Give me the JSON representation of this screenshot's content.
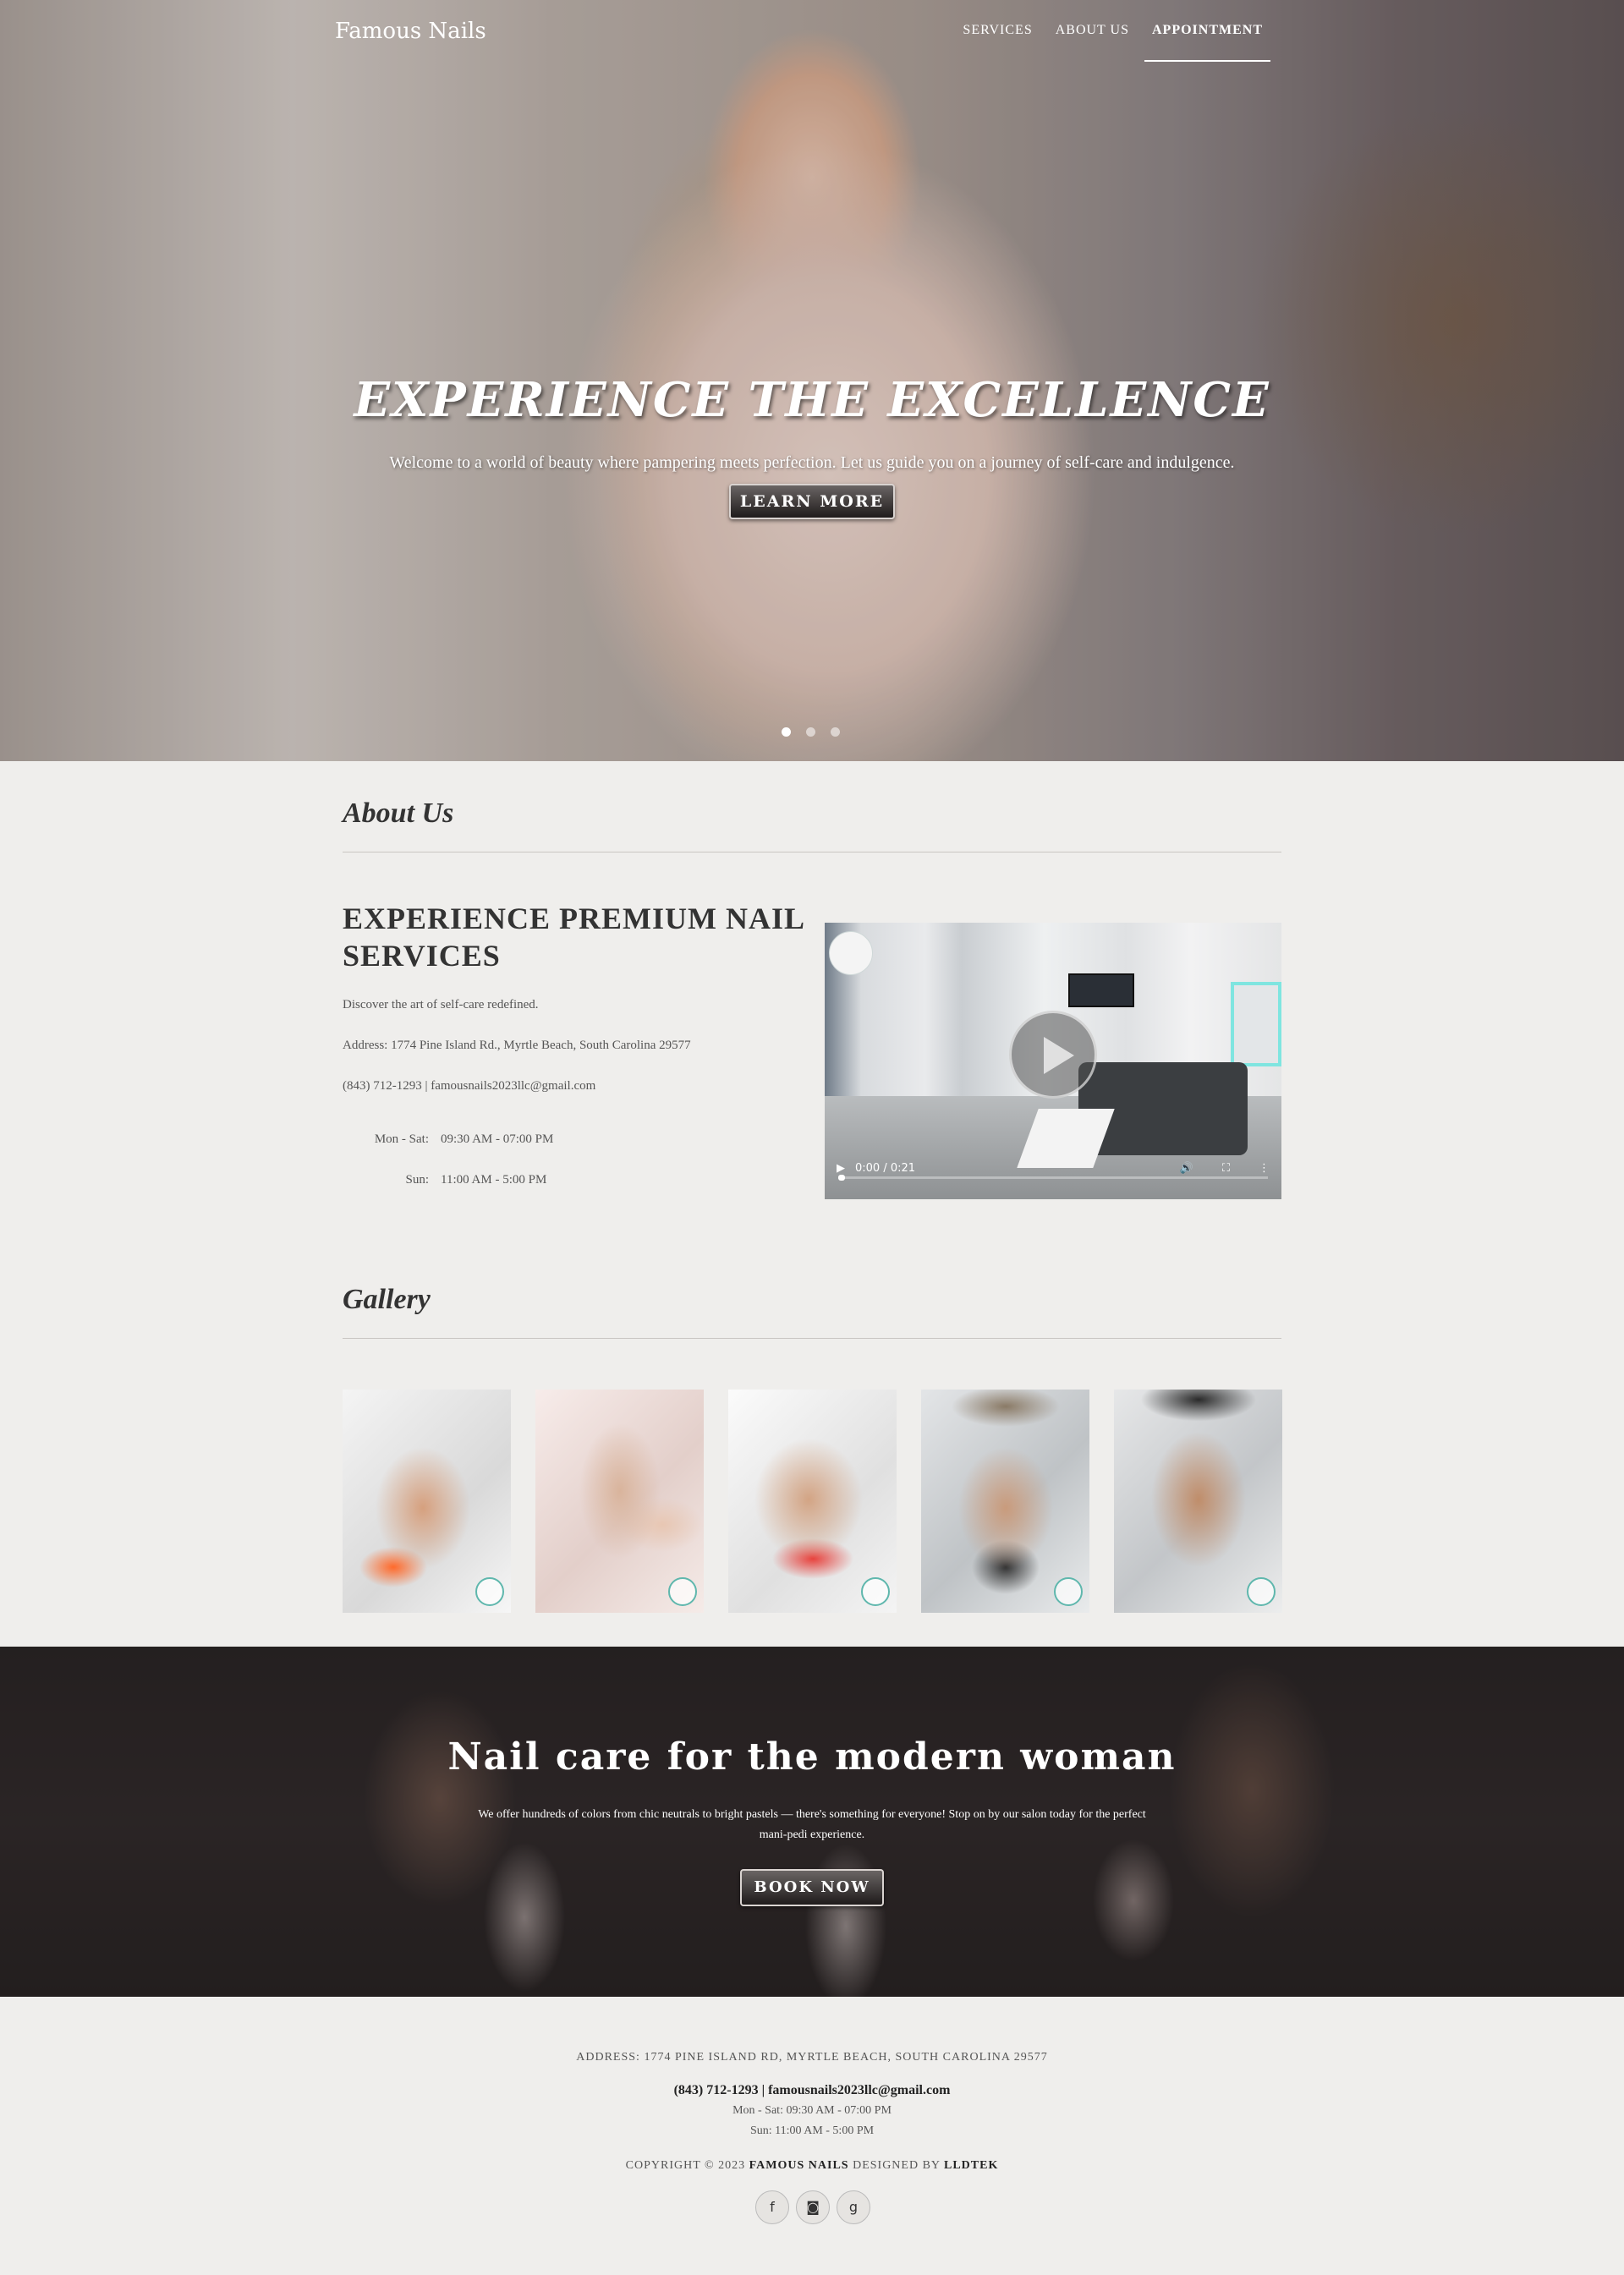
{
  "nav": {
    "brand": "Famous Nails",
    "links": [
      "SERVICES",
      "ABOUT US",
      "APPOINTMENT"
    ],
    "active": "APPOINTMENT"
  },
  "hero": {
    "title": "EXPERIENCE THE EXCELLENCE",
    "subtitle": "Welcome to a world of beauty where pampering meets perfection. Let us guide you on a journey of self-care and indulgence.",
    "button": "LEARN MORE",
    "slide_count": 3,
    "active_slide": 1
  },
  "about": {
    "section_title": "About Us",
    "heading": "EXPERIENCE PREMIUM NAIL SERVICES",
    "tagline": "Discover the art of self-care redefined.",
    "address": "Address: 1774 Pine Island Rd., Myrtle Beach, South Carolina 29577",
    "contact": "(843) 712-1293 | famousnails2023llc@gmail.com",
    "hours": [
      {
        "label": "Mon - Sat:",
        "value": "09:30 AM - 07:00 PM"
      },
      {
        "label": "Sun:",
        "value": "11:00 AM - 5:00 PM"
      }
    ],
    "video": {
      "time": "0:00 / 0:21",
      "progress": 0
    }
  },
  "gallery": {
    "section_title": "Gallery",
    "items": [
      "gallery-photo-1",
      "gallery-photo-2",
      "gallery-photo-3",
      "gallery-photo-4",
      "gallery-photo-5"
    ]
  },
  "banner": {
    "title": "Nail care for the modern woman",
    "text": "We offer hundreds of colors from chic neutrals to bright pastels — there's something for everyone! Stop on by our salon today for the perfect mani-pedi experience.",
    "button": "BOOK NOW"
  },
  "footer": {
    "address": "ADDRESS: 1774 PINE ISLAND RD, MYRTLE BEACH, SOUTH CAROLINA 29577",
    "contact": "(843) 712-1293 | famousnails2023llc@gmail.com",
    "hours_weekday": "Mon - Sat: 09:30 AM - 07:00 PM",
    "hours_sunday": "Sun: 11:00 AM - 5:00 PM",
    "copyright_prefix": "COPYRIGHT © 2023",
    "copyright_brand": "FAMOUS NAILS",
    "designed_by_label": "DESIGNED BY",
    "designer": "LLDTEK",
    "socials": [
      "facebook-icon",
      "instagram-icon",
      "google-plus-icon"
    ]
  }
}
